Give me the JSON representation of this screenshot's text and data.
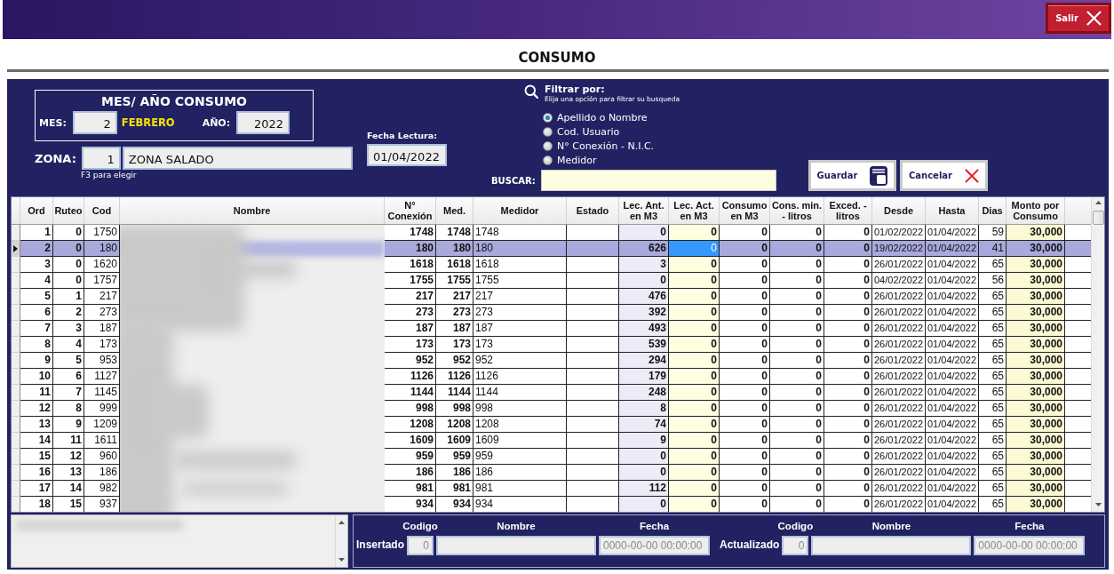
{
  "top_bar": {
    "exit_button": {
      "label": "Salir"
    }
  },
  "title": "CONSUMO",
  "period": {
    "heading": "MES/ AÑO CONSUMO",
    "month_label": "MES:",
    "month": "2",
    "month_name": "FEBRERO",
    "year_label": "AÑO:",
    "year": "2022"
  },
  "zone": {
    "label": "ZONA:",
    "code": "1",
    "name": "ZONA SALADO",
    "hint": "F3 para elegir"
  },
  "reading_date": {
    "label": "Fecha Lectura:",
    "value": "01/04/2022"
  },
  "filter": {
    "title": "Filtrar por:",
    "subtitle": "Elija una opción para filtrar su busqueda",
    "options": [
      {
        "label": "Apellido o Nombre",
        "selected": true
      },
      {
        "label": "Cod. Usuario",
        "selected": false
      },
      {
        "label": "N° Conexión - N.I.C.",
        "selected": false
      },
      {
        "label": "Medidor",
        "selected": false
      }
    ]
  },
  "search": {
    "label": "BUSCAR:"
  },
  "buttons": [
    {
      "label": "Guardar",
      "kind": "save"
    },
    {
      "label": "Cancelar",
      "kind": "cancel"
    }
  ],
  "table": {
    "columns": [
      {
        "label": "Ord",
        "kind": "bold"
      },
      {
        "label": "Ruteo",
        "kind": "bold"
      },
      {
        "label": "Cod",
        "kind": "plain"
      },
      {
        "label": "Nombre",
        "kind": "blurred"
      },
      {
        "label": "N° Conexión",
        "kind": "bold"
      },
      {
        "label": "Med.",
        "kind": "bold"
      },
      {
        "label": "Medidor",
        "kind": "left"
      },
      {
        "label": "Estado",
        "kind": "left"
      },
      {
        "label": "Lec. Ant. en M3",
        "kind": "previous"
      },
      {
        "label": "Lec. Act. en M3",
        "kind": "current"
      },
      {
        "label": "Consumo en M3",
        "kind": "bold"
      },
      {
        "label": "Cons. min. - litros",
        "kind": "bold"
      },
      {
        "label": "Exced. - litros",
        "kind": "bold"
      },
      {
        "label": "Desde",
        "kind": "date"
      },
      {
        "label": "Hasta",
        "kind": "date"
      },
      {
        "label": "Dias",
        "kind": "plain"
      },
      {
        "label": "Monto por Consumo",
        "kind": "amount"
      }
    ],
    "rows": [
      {
        "selected": false,
        "editing": false,
        "cells": [
          "1",
          "0",
          "1750",
          "",
          "1748",
          "1748",
          "1748",
          "",
          "0",
          "0",
          "0",
          "0",
          "0",
          "01/02/2022",
          "01/04/2022",
          "59",
          "30,000"
        ]
      },
      {
        "selected": true,
        "editing": true,
        "cells": [
          "2",
          "0",
          "180",
          "",
          "180",
          "180",
          "180",
          "",
          "626",
          "0",
          "0",
          "0",
          "0",
          "19/02/2022",
          "01/04/2022",
          "41",
          "30,000"
        ]
      },
      {
        "selected": false,
        "editing": false,
        "cells": [
          "3",
          "0",
          "1620",
          "",
          "1618",
          "1618",
          "1618",
          "",
          "3",
          "0",
          "0",
          "0",
          "0",
          "26/01/2022",
          "01/04/2022",
          "65",
          "30,000"
        ]
      },
      {
        "selected": false,
        "editing": false,
        "cells": [
          "4",
          "0",
          "1757",
          "",
          "1755",
          "1755",
          "1755",
          "",
          "0",
          "0",
          "0",
          "0",
          "0",
          "04/02/2022",
          "01/04/2022",
          "56",
          "30,000"
        ]
      },
      {
        "selected": false,
        "editing": false,
        "cells": [
          "5",
          "1",
          "217",
          "",
          "217",
          "217",
          "217",
          "",
          "476",
          "0",
          "0",
          "0",
          "0",
          "26/01/2022",
          "01/04/2022",
          "65",
          "30,000"
        ]
      },
      {
        "selected": false,
        "editing": false,
        "cells": [
          "6",
          "2",
          "273",
          "",
          "273",
          "273",
          "273",
          "",
          "392",
          "0",
          "0",
          "0",
          "0",
          "26/01/2022",
          "01/04/2022",
          "65",
          "30,000"
        ]
      },
      {
        "selected": false,
        "editing": false,
        "cells": [
          "7",
          "3",
          "187",
          "",
          "187",
          "187",
          "187",
          "",
          "493",
          "0",
          "0",
          "0",
          "0",
          "26/01/2022",
          "01/04/2022",
          "65",
          "30,000"
        ]
      },
      {
        "selected": false,
        "editing": false,
        "cells": [
          "8",
          "4",
          "173",
          "",
          "173",
          "173",
          "173",
          "",
          "539",
          "0",
          "0",
          "0",
          "0",
          "26/01/2022",
          "01/04/2022",
          "65",
          "30,000"
        ]
      },
      {
        "selected": false,
        "editing": false,
        "cells": [
          "9",
          "5",
          "953",
          "",
          "952",
          "952",
          "952",
          "",
          "294",
          "0",
          "0",
          "0",
          "0",
          "26/01/2022",
          "01/04/2022",
          "65",
          "30,000"
        ]
      },
      {
        "selected": false,
        "editing": false,
        "cells": [
          "10",
          "6",
          "1127",
          "",
          "1126",
          "1126",
          "1126",
          "",
          "179",
          "0",
          "0",
          "0",
          "0",
          "26/01/2022",
          "01/04/2022",
          "65",
          "30,000"
        ]
      },
      {
        "selected": false,
        "editing": false,
        "cells": [
          "11",
          "7",
          "1145",
          "",
          "1144",
          "1144",
          "1144",
          "",
          "248",
          "0",
          "0",
          "0",
          "0",
          "26/01/2022",
          "01/04/2022",
          "65",
          "30,000"
        ]
      },
      {
        "selected": false,
        "editing": false,
        "cells": [
          "12",
          "8",
          "999",
          "",
          "998",
          "998",
          "998",
          "",
          "8",
          "0",
          "0",
          "0",
          "0",
          "26/01/2022",
          "01/04/2022",
          "65",
          "30,000"
        ]
      },
      {
        "selected": false,
        "editing": false,
        "cells": [
          "13",
          "9",
          "1209",
          "",
          "1208",
          "1208",
          "1208",
          "",
          "74",
          "0",
          "0",
          "0",
          "0",
          "26/01/2022",
          "01/04/2022",
          "65",
          "30,000"
        ]
      },
      {
        "selected": false,
        "editing": false,
        "cells": [
          "14",
          "11",
          "1611",
          "",
          "1609",
          "1609",
          "1609",
          "",
          "9",
          "0",
          "0",
          "0",
          "0",
          "26/01/2022",
          "01/04/2022",
          "65",
          "30,000"
        ]
      },
      {
        "selected": false,
        "editing": false,
        "cells": [
          "15",
          "12",
          "960",
          "",
          "959",
          "959",
          "959",
          "",
          "0",
          "0",
          "0",
          "0",
          "0",
          "26/01/2022",
          "01/04/2022",
          "65",
          "30,000"
        ]
      },
      {
        "selected": false,
        "editing": false,
        "cells": [
          "16",
          "13",
          "186",
          "",
          "186",
          "186",
          "186",
          "",
          "0",
          "0",
          "0",
          "0",
          "0",
          "26/01/2022",
          "01/04/2022",
          "65",
          "30,000"
        ]
      },
      {
        "selected": false,
        "editing": false,
        "cells": [
          "17",
          "14",
          "982",
          "",
          "981",
          "981",
          "981",
          "",
          "112",
          "0",
          "0",
          "0",
          "0",
          "26/01/2022",
          "01/04/2022",
          "65",
          "30,000"
        ]
      },
      {
        "selected": false,
        "editing": false,
        "cells": [
          "18",
          "15",
          "937",
          "",
          "934",
          "934",
          "934",
          "",
          "0",
          "0",
          "0",
          "0",
          "0",
          "26/01/2022",
          "01/04/2022",
          "65",
          "30,000"
        ]
      }
    ]
  },
  "audit": [
    {
      "label": "Insertado",
      "headers": [
        "Codigo",
        "Nombre",
        "Fecha"
      ],
      "code": "0",
      "date": "0000-00-00 00:00:00"
    },
    {
      "label": "Actualizado",
      "headers": [
        "Codigo",
        "Nombre",
        "Fecha"
      ],
      "code": "0",
      "date": "0000-00-00 00:00:00"
    }
  ]
}
